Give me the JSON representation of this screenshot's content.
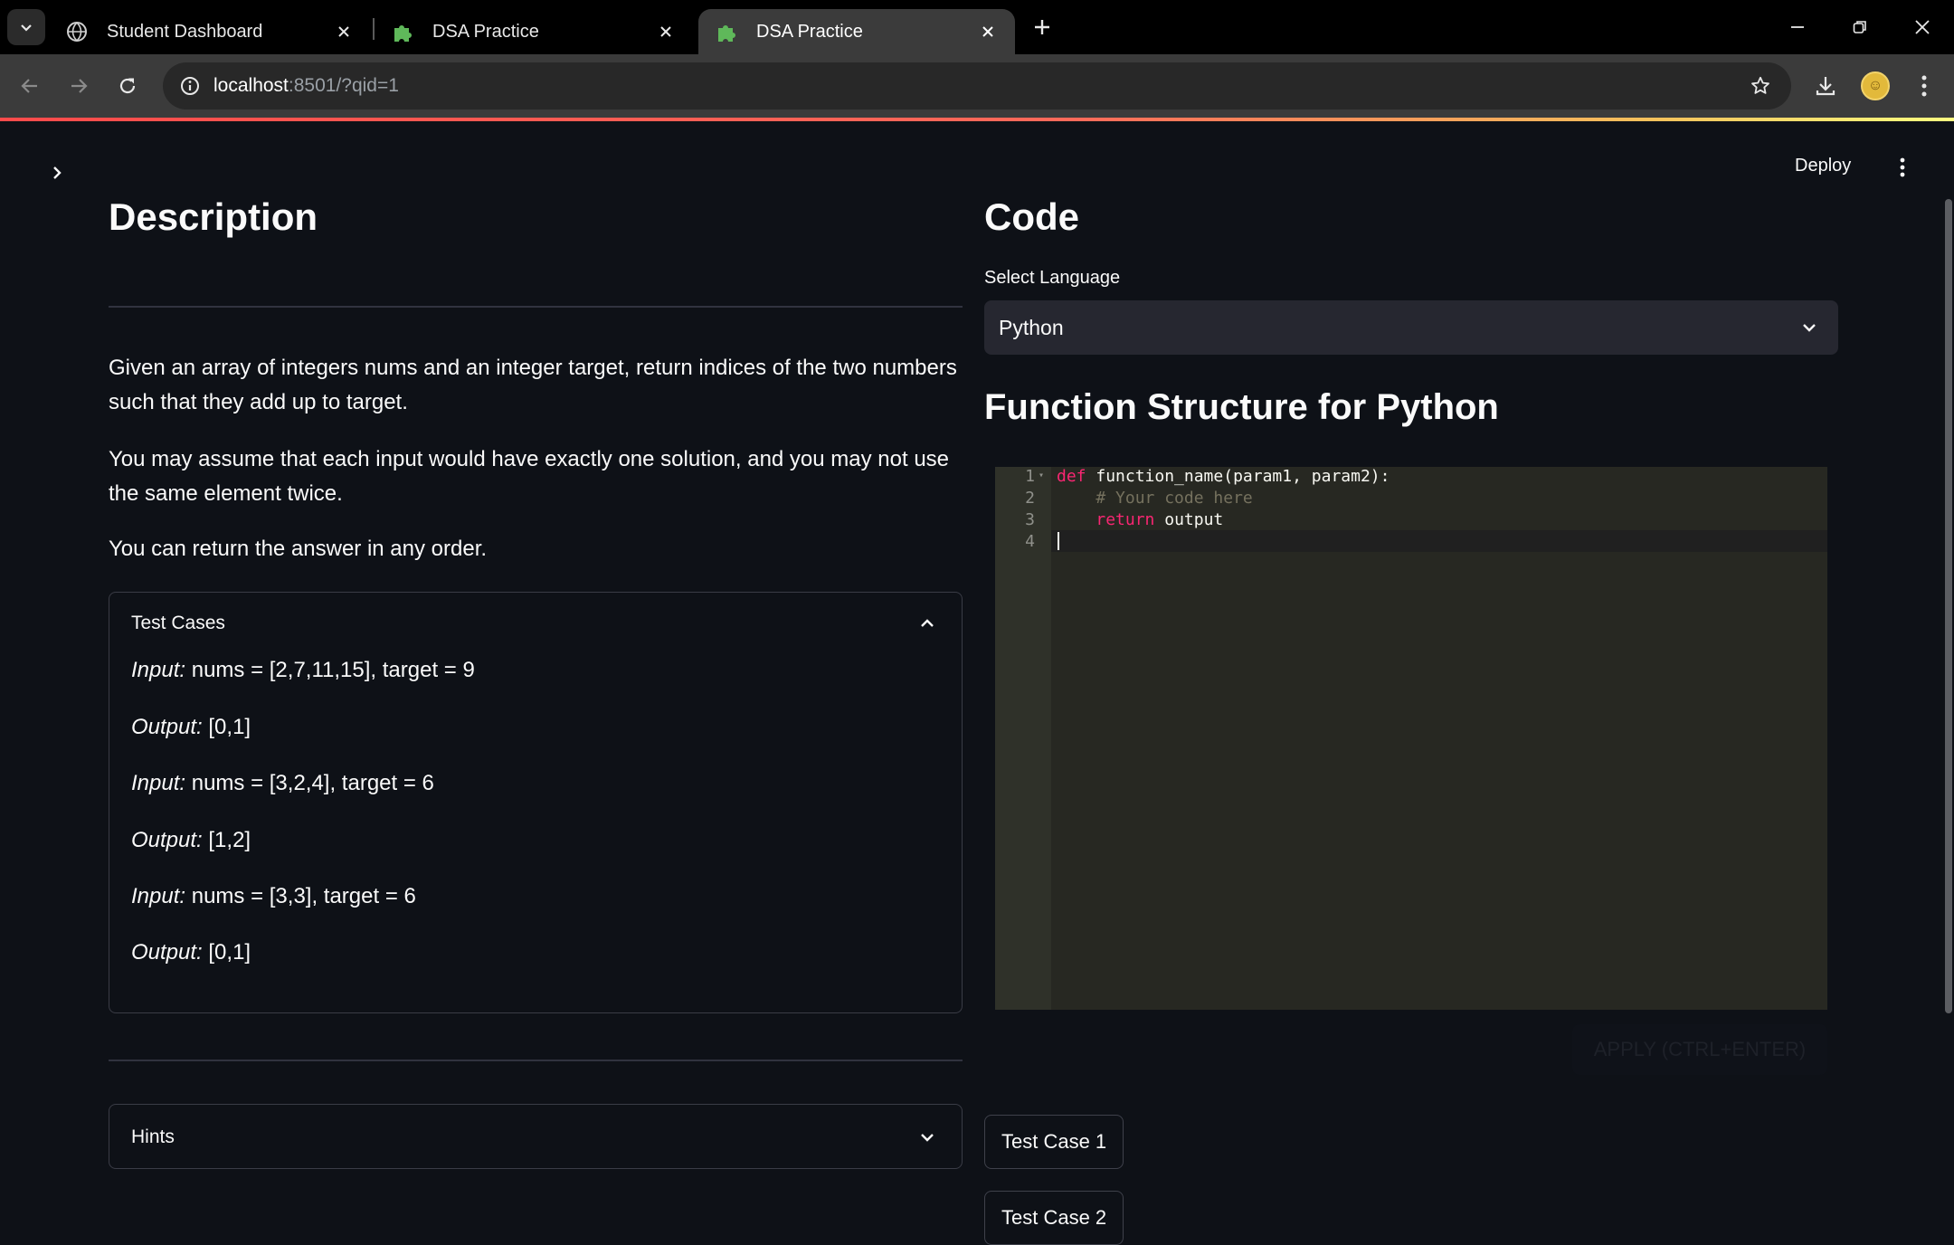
{
  "browser": {
    "tabs": [
      {
        "title": "Student Dashboard",
        "icon": "globe-icon",
        "active": false
      },
      {
        "title": "DSA Practice",
        "icon": "puzzle-icon",
        "active": false
      },
      {
        "title": "DSA Practice",
        "icon": "puzzle-icon",
        "active": true
      }
    ],
    "url_host": "localhost",
    "url_rest": ":8501/?qid=1"
  },
  "app": {
    "deploy_label": "Deploy",
    "description": {
      "heading": "Description",
      "paragraphs": [
        "Given an array of integers nums and an integer target, return indices of the two numbers such that they add up to target.",
        "You may assume that each input would have exactly one solution, and you may not use the same element twice.",
        "You can return the answer in any order."
      ],
      "test_cases": {
        "title": "Test Cases",
        "expanded": true,
        "input_label": "Input:",
        "output_label": "Output:",
        "items": [
          {
            "input": "nums = [2,7,11,15], target = 9",
            "output": "[0,1]"
          },
          {
            "input": "nums = [3,2,4], target = 6",
            "output": "[1,2]"
          },
          {
            "input": "nums = [3,3], target = 6",
            "output": "[0,1]"
          }
        ]
      },
      "hints": {
        "title": "Hints",
        "expanded": false
      }
    },
    "code": {
      "heading": "Code",
      "language_label": "Select Language",
      "language_value": "Python",
      "function_heading": "Function Structure for Python",
      "editor": {
        "line_numbers": [
          "1",
          "2",
          "3",
          "4"
        ],
        "line1_kw": "def",
        "line1_rest": " function_name(param1, param2):",
        "line2_comment": "    # Your code here",
        "line3_indent": "    ",
        "line3_kw": "return",
        "line3_rest": " output"
      },
      "apply_label": "APPLY (CTRL+ENTER)",
      "test_case_buttons": [
        "Test Case 1",
        "Test Case 2"
      ]
    }
  },
  "colors": {
    "app_background": "#0e1117",
    "accent": "#ff4b4b",
    "editor_background": "#272822",
    "keyword": "#f92672",
    "comment": "#75715e"
  }
}
